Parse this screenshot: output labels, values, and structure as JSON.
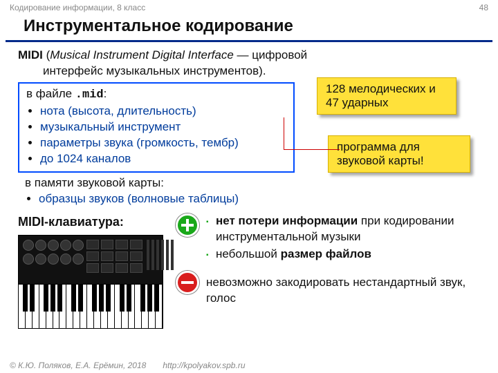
{
  "header": {
    "course": "Кодирование информации, 8 класс",
    "page": "48"
  },
  "title": "Инструментальное кодирование",
  "midi": {
    "abbr": "MIDI",
    "expansion_en": "Musical Instrument Digital Interface",
    "dash": " — ",
    "expansion_ru1": "цифровой",
    "expansion_ru2": "интерфейс музыкальных инструментов)."
  },
  "file": {
    "intro_a": "в файле ",
    "ext": ".mid",
    "intro_b": ":",
    "items": [
      "нота (высота, длительность)",
      "музыкальный инструмент",
      "параметры звука (громкость, тембр)",
      "до 1024 каналов"
    ]
  },
  "callouts": {
    "c1": "128 мелодических и 47 ударных",
    "c2": "программа для звуковой карты!"
  },
  "memory": {
    "intro": "в памяти звуковой карты:",
    "item": "образцы звуков (волновые таблицы)"
  },
  "kb_label": "MIDI-клавиатура:",
  "advantages": {
    "a1a": "нет потери информации",
    "a1b": " при кодировании инструментальной музыки",
    "a2a": "небольшой ",
    "a2b": "размер файлов"
  },
  "disadvantage": "невозможно закодировать нестандартный звук, голос",
  "footer": {
    "author": "© К.Ю. Поляков, Е.А. Ерёмин, 2018",
    "url": "http://kpolyakov.spb.ru"
  }
}
